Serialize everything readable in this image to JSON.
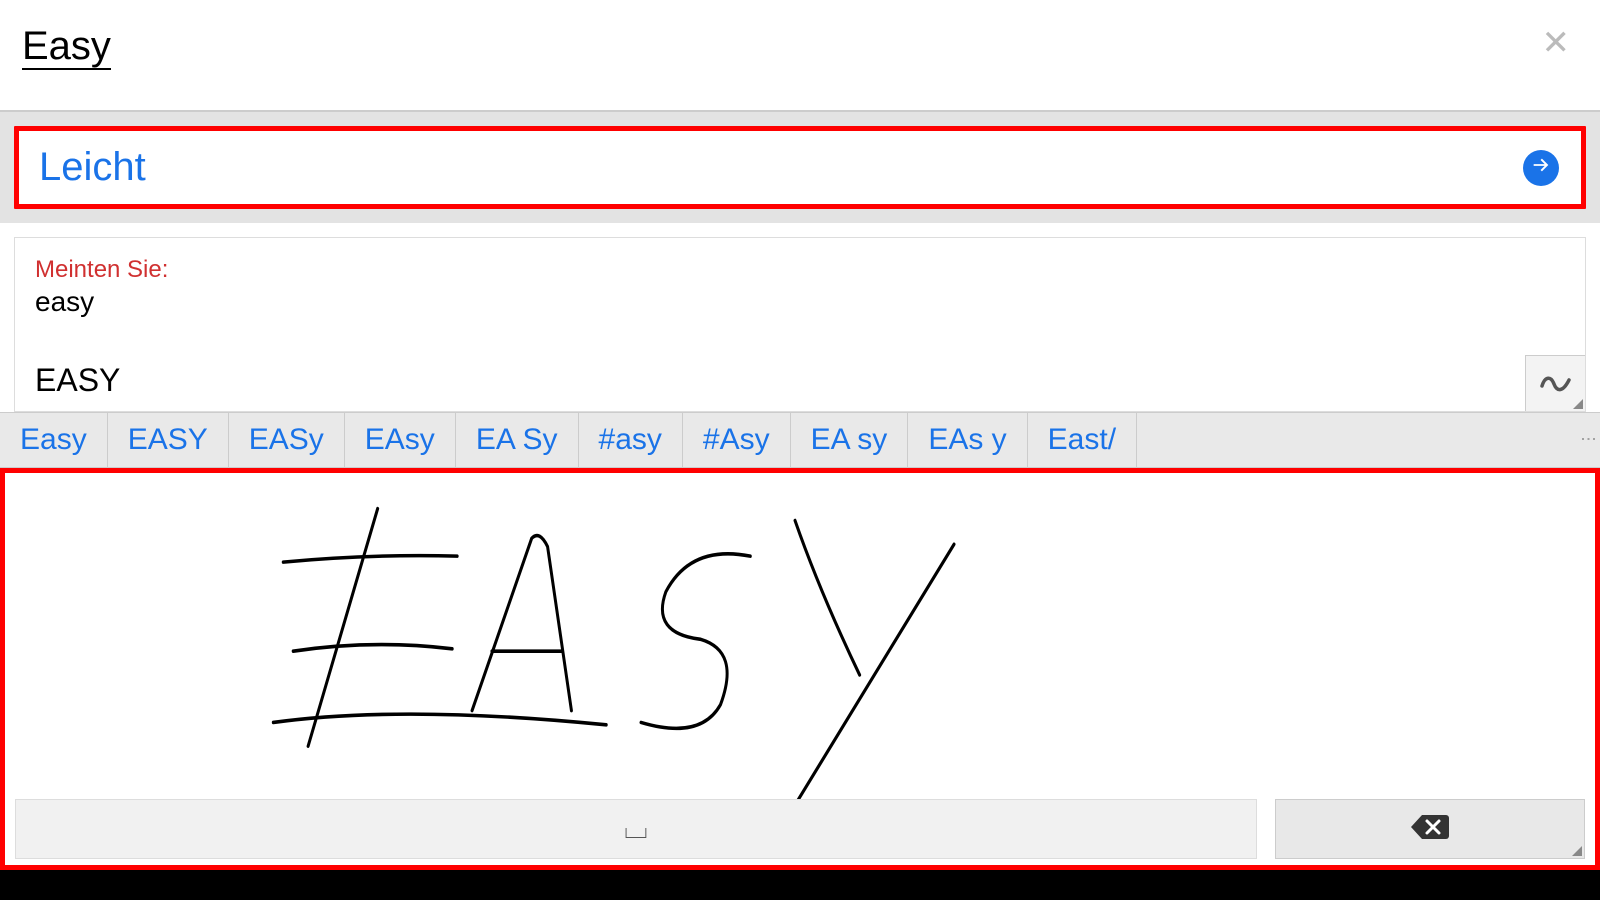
{
  "header": {
    "title": "Easy"
  },
  "translation": {
    "result": "Leicht"
  },
  "suggestion": {
    "label": "Meinten Sie:",
    "word": "easy"
  },
  "dictionary": {
    "headword": "EASY"
  },
  "candidates": [
    "Easy",
    "EASY",
    "EASy",
    "EAsy",
    "EA Sy",
    "#asy",
    "#Asy",
    "EA sy",
    "EAs y",
    "East/"
  ],
  "handwriting": {
    "drawn_text": "EASY"
  },
  "colors": {
    "highlight": "#ff0000",
    "link": "#1a73e8",
    "error": "#d03030"
  }
}
